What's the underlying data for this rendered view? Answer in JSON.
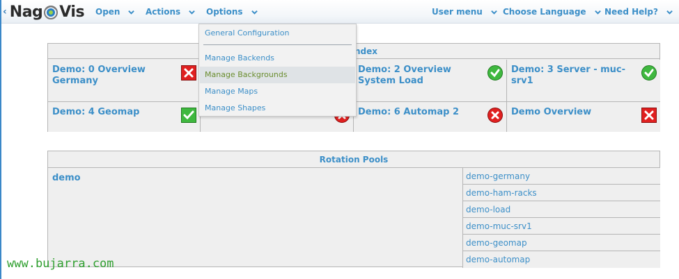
{
  "header": {
    "logo_text_left": "Nag",
    "logo_text_right": "Vis",
    "menus_left": [
      {
        "label": "Open"
      },
      {
        "label": "Actions"
      },
      {
        "label": "Options"
      }
    ],
    "menus_right": [
      {
        "label": "User menu"
      },
      {
        "label": "Choose Language"
      },
      {
        "label": "Need Help?"
      }
    ]
  },
  "options_menu": {
    "items": [
      {
        "label": "General Configuration"
      },
      {
        "label": "Manage Backends"
      },
      {
        "label": "Manage Backgrounds",
        "active": true
      },
      {
        "label": "Manage Maps"
      },
      {
        "label": "Manage Shapes"
      }
    ]
  },
  "maps": {
    "title_visible": "ndex",
    "cells": [
      {
        "title": "Demo: 0 Overview Germany",
        "status": "critical"
      },
      {
        "title": "Demo: 2 Overview System Load",
        "status": "ok"
      },
      {
        "title": "Demo: 3 Server - muc-srv1",
        "status": "ok"
      },
      {
        "title": "Demo: 4 Geomap",
        "status": "ok"
      },
      {
        "title": "Demo: 6 Automap 2",
        "status": "critical"
      },
      {
        "title": "Demo Overview",
        "status": "critical"
      }
    ]
  },
  "rotation_pools": {
    "title": "Rotation Pools",
    "pool_name": "demo",
    "maps": [
      "demo-germany",
      "demo-ham-racks",
      "demo-load",
      "demo-muc-srv1",
      "demo-geomap",
      "demo-automap"
    ]
  },
  "watermark": "www.bujarra.com",
  "colors": {
    "link": "#3c8fc8",
    "active_menu_text": "#6a8d2e",
    "ok": "#3fb83f",
    "critical": "#e02020",
    "watermark": "#2f9f2f"
  }
}
